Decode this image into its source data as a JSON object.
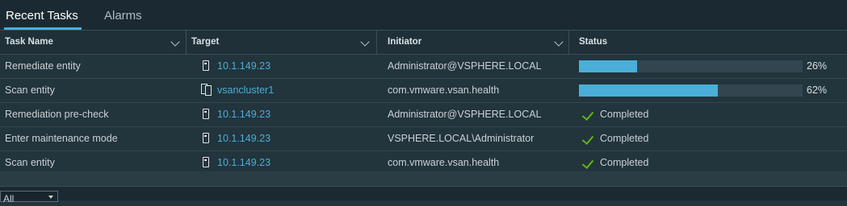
{
  "tabs": {
    "recent": "Recent Tasks",
    "alarms": "Alarms"
  },
  "columns": {
    "task_name": "Task Name",
    "target": "Target",
    "initiator": "Initiator",
    "status": "Status"
  },
  "rows": [
    {
      "task": "Remediate entity",
      "target": "10.1.149.23",
      "target_icon": "host-icon",
      "initiator": "Administrator@VSPHERE.LOCAL",
      "status_type": "progress",
      "progress": 26,
      "progress_label": "26%"
    },
    {
      "task": "Scan entity",
      "target": "vsancluster1",
      "target_icon": "cluster-icon",
      "initiator": "com.vmware.vsan.health",
      "status_type": "progress",
      "progress": 62,
      "progress_label": "62%"
    },
    {
      "task": "Remediation pre-check",
      "target": "10.1.149.23",
      "target_icon": "host-icon",
      "initiator": "Administrator@VSPHERE.LOCAL",
      "status_type": "completed",
      "status": "Completed"
    },
    {
      "task": "Enter maintenance mode",
      "target": "10.1.149.23",
      "target_icon": "host-icon",
      "initiator": "VSPHERE.LOCAL\\Administrator",
      "status_type": "completed",
      "status": "Completed"
    },
    {
      "task": "Scan entity",
      "target": "10.1.149.23",
      "target_icon": "host-icon",
      "initiator": "com.vmware.vsan.health",
      "status_type": "completed",
      "status": "Completed"
    }
  ],
  "footer": {
    "filter_value": "All"
  },
  "colors": {
    "accent": "#49afd9",
    "success": "#60b515",
    "background": "#22343c"
  }
}
